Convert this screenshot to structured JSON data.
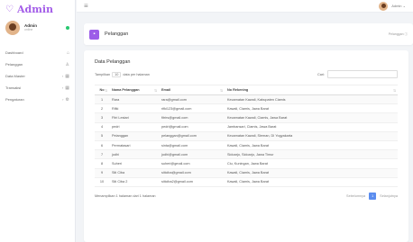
{
  "brand": {
    "icon": "heart-icon",
    "text": "Admin"
  },
  "user": {
    "name": "Admin",
    "status": "online"
  },
  "sidebar": {
    "items": [
      {
        "label": "Dashboard",
        "icon": "home-icon",
        "chevron": ""
      },
      {
        "label": "Pelanggan",
        "icon": "users-icon",
        "chevron": ""
      },
      {
        "label": "Data Master",
        "icon": "grid-icon",
        "chevron": "›"
      },
      {
        "label": "Transaksi",
        "icon": "cart-icon",
        "chevron": "›"
      },
      {
        "label": "Pengaturan",
        "icon": "gear-icon",
        "chevron": "›"
      }
    ]
  },
  "navbar": {
    "user_label": "Admin ⌄"
  },
  "page_header": {
    "title": "Pelanggan",
    "breadcrumb": "Pelanggan ⓘ"
  },
  "card": {
    "title": "Data Pelanggan",
    "show_prefix": "Tampilkan",
    "show_value": "10",
    "show_suffix": "data per halaman",
    "search_label": "Cari:",
    "search_placeholder": ""
  },
  "table": {
    "headers": [
      "No",
      "Nama Pelanggan",
      "Email",
      "No Rekening"
    ],
    "rows": [
      [
        "1",
        "Rara",
        "rara@gmail.com",
        "Kecamatan Kawali, Kabupaten Ciamis"
      ],
      [
        "2",
        "Rifki",
        "rifki123@gmail.com",
        "Kawali, Ciamis, Jawa Barat"
      ],
      [
        "3",
        "Fitri Lestari",
        "fitrirs@gmail.com",
        "Kecamatan Kawali, Ciamis, Jawa Barat"
      ],
      [
        "4",
        "pedri",
        "pedri@gmail.com",
        "Jambansari, Ciamis, Jawa Barat"
      ],
      [
        "5",
        "Pelanggan",
        "pelanggan@gmail.com",
        "Kecamatan Kawali, Sleman, DI Yogyakarta"
      ],
      [
        "6",
        "Permatasari",
        "sinta@gmail.com",
        "Kawali, Ciamis, Jawa Barat"
      ],
      [
        "7",
        "jodhi",
        "jodhi@gmail.com",
        "Sidoarjo, Sidoarjo, Jawa Timur"
      ],
      [
        "8",
        "Suheri",
        "suheri@gmail.com",
        "Ciu, Kuningan, Jawa Barat"
      ],
      [
        "9",
        "Siti Ciba",
        "siticiba@gmail.com",
        "Kawali, Ciamis, Jawa Barat"
      ],
      [
        "10",
        "Siti Ciba 2",
        "siticiba2@gmail.com",
        "Kawali, Ciamis, Jawa Barat"
      ]
    ]
  },
  "footer": {
    "info": "Menampilkan 1 halaman dari 1 halaman",
    "prev": "Sebelumnya",
    "page": "1",
    "next": "Selanjutnya"
  },
  "colors": {
    "accent": "#9c5de8",
    "online": "#28c76f",
    "pager": "#5b8def"
  }
}
